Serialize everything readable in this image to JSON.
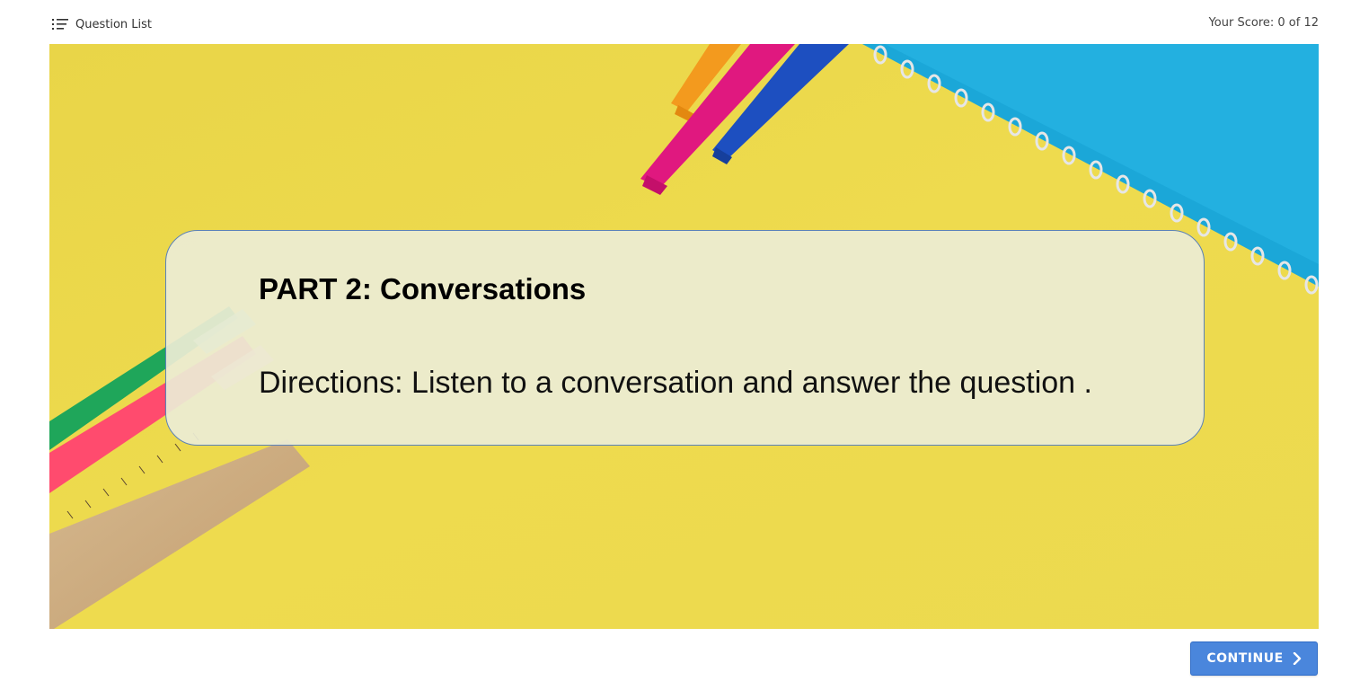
{
  "header": {
    "question_list_label": "Question List",
    "question_list_icon": "list-icon",
    "score_text": "Your Score: 0 of 12"
  },
  "slide": {
    "title": "PART 2: Conversations",
    "directions": "Directions: Listen to a conversation and answer the question .",
    "background_image": "school supplies on yellow background",
    "colors": {
      "background_yellow": "#ecd64b",
      "card_border": "#5b82b8",
      "notebook_blue": "#1aa6d6"
    }
  },
  "footer": {
    "continue_label": "CONTINUE",
    "continue_icon": "chevron-right-icon",
    "button_color": "#4a86dc"
  }
}
